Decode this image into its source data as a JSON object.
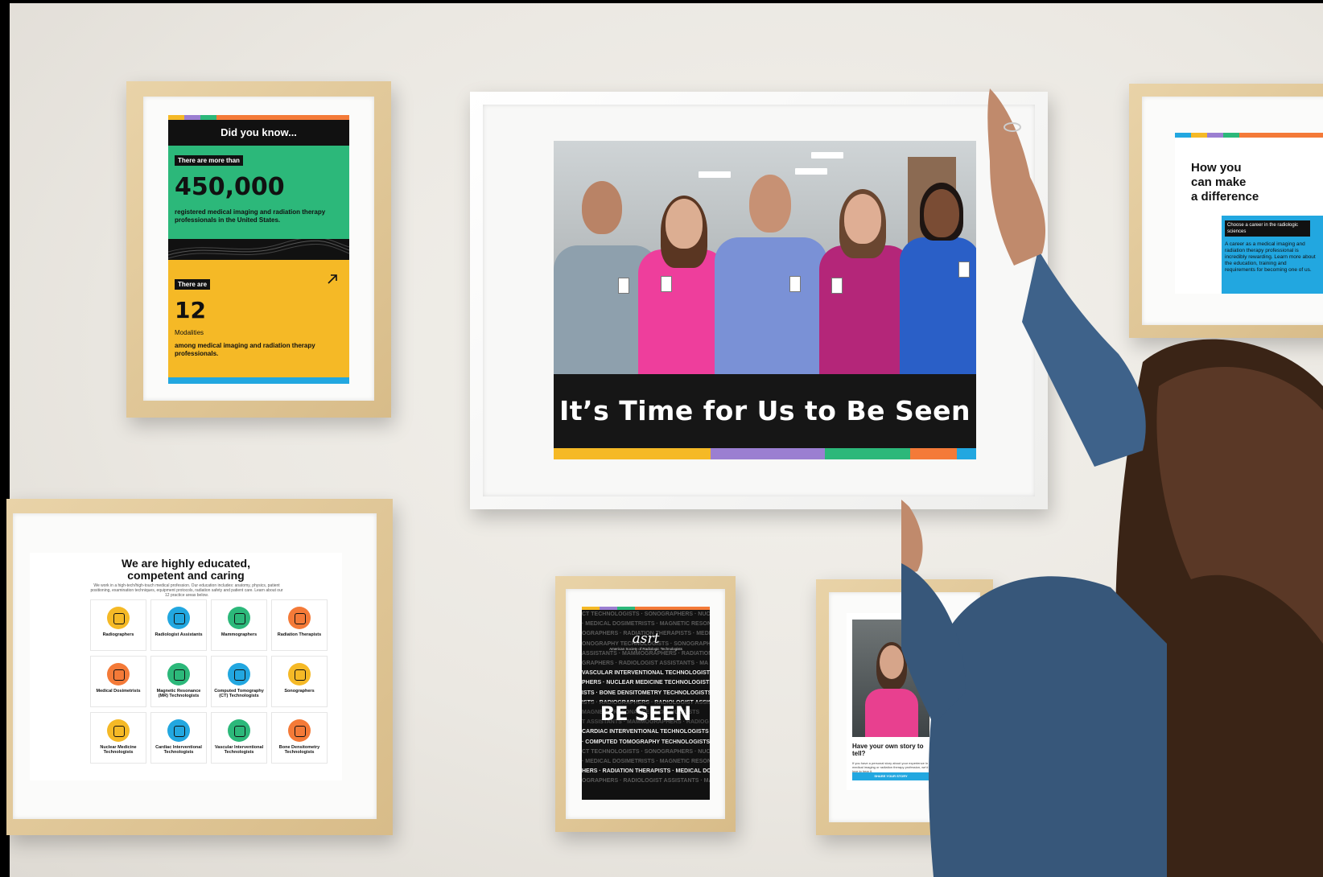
{
  "scene": {
    "colors": {
      "wall": "#ebe8e2",
      "frame_wood": "#dcc18f",
      "accent_green": "#2cb87a",
      "accent_yellow": "#f5b926",
      "accent_purple": "#9b7fd1",
      "accent_orange": "#f47a38",
      "accent_blue": "#22a7e0",
      "accent_pink": "#e94fa0"
    }
  },
  "poster_stats": {
    "heading": "Did you know...",
    "tag1": "There are more than",
    "stat1": "450,000",
    "desc1": "registered medical imaging and radiation therapy professionals in the United States.",
    "tag2": "There are",
    "stat2": "12",
    "stat2_unit": "Modalities",
    "desc2": "among medical imaging and radiation therapy professionals.",
    "arrow_icon": "arrow-up-right-icon"
  },
  "poster_main": {
    "caption": "It’s Time for Us to Be Seen"
  },
  "poster_difference": {
    "title_line1": "How you",
    "title_line2": "can make",
    "title_line3": "a difference",
    "tag": "Choose a career in the radiologic sciences",
    "body": "A career as a medical imaging and radiation therapy professional is incredibly rewarding. Learn more about the education, training and requirements for becoming one of us."
  },
  "poster_grid": {
    "title_line1": "We are highly educated,",
    "title_line2": "competent and caring",
    "intro": "We work in a high-tech/high-touch medical profession. Our education includes: anatomy, physics, patient positioning, examination techniques, equipment protocols, radiation safety and patient care. Learn about our 12 practice areas below.",
    "tiles": [
      {
        "label": "Radiographers",
        "color": "#f5b926"
      },
      {
        "label": "Radiologist Assistants",
        "color": "#22a7e0"
      },
      {
        "label": "Mammographers",
        "color": "#2cb87a"
      },
      {
        "label": "Radiation Therapists",
        "color": "#f47a38"
      },
      {
        "label": "Medical Dosimetrists",
        "color": "#f47a38"
      },
      {
        "label": "Magnetic Resonance (MR) Technologists",
        "color": "#2cb87a"
      },
      {
        "label": "Computed Tomography (CT) Technologists",
        "color": "#22a7e0"
      },
      {
        "label": "Sonographers",
        "color": "#f5b926"
      },
      {
        "label": "Nuclear Medicine Technologists",
        "color": "#f5b926"
      },
      {
        "label": "Cardiac Interventional Technologists",
        "color": "#22a7e0"
      },
      {
        "label": "Vascular Interventional Technologists",
        "color": "#2cb87a"
      },
      {
        "label": "Bone Densitometry Technologists",
        "color": "#f47a38"
      }
    ]
  },
  "poster_beseen": {
    "logo": "asrt",
    "logo_sub": "American Society of Radiologic Technologists",
    "headline": "BE SEEN",
    "lines": [
      "CT TECHNOLOGISTS · SONOGRAPHERS · NUCLE",
      "· MEDICAL DOSIMETRISTS · MAGNETIC RESON",
      "OGRAPHERS · RADIATION THERAPISTS · MEDICA",
      "ONOGRAPHY TECHNOLOGISTS · SONOGRAPH",
      "ASSISTANTS · MAMMOGRAPHERS · RADIATION T",
      "GRAPHERS · RADIOLOGIST ASSISTANTS · MA",
      "VASCULAR INTERVENTIONAL TECHNOLOGISTS",
      "PHERS · NUCLEAR MEDICINE TECHNOLOGISTS",
      "ISTS · BONE DENSITOMETRY TECHNOLOGISTS",
      "ISTS · RADIOGRAPHERS · RADIOLOGIST ASSIS",
      "MAGNETIC RESONANCE TECHNOLOGISTS",
      "T ASSISTANTS · MAMMOGRAPHERS · RADIOG",
      "CARDIAC INTERVENTIONAL TECHNOLOGISTS",
      "· COMPUTED TOMOGRAPHY TECHNOLOGISTS",
      "CT TECHNOLOGISTS · SONOGRAPHERS · NUCLE",
      "· MEDICAL DOSIMETRISTS · MAGNETIC RESON",
      "HERS · RADIATION THERAPISTS · MEDICAL DOSI",
      "OGRAPHERS · RADIOLOGIST ASSISTANTS · MA"
    ]
  },
  "poster_story": {
    "question": "Have your own story to tell?",
    "body": "If you have a personal story about your experience in medical imaging or radiation therapy profession, we'd love to hear it.",
    "button": "SHARE YOUR STORY"
  }
}
